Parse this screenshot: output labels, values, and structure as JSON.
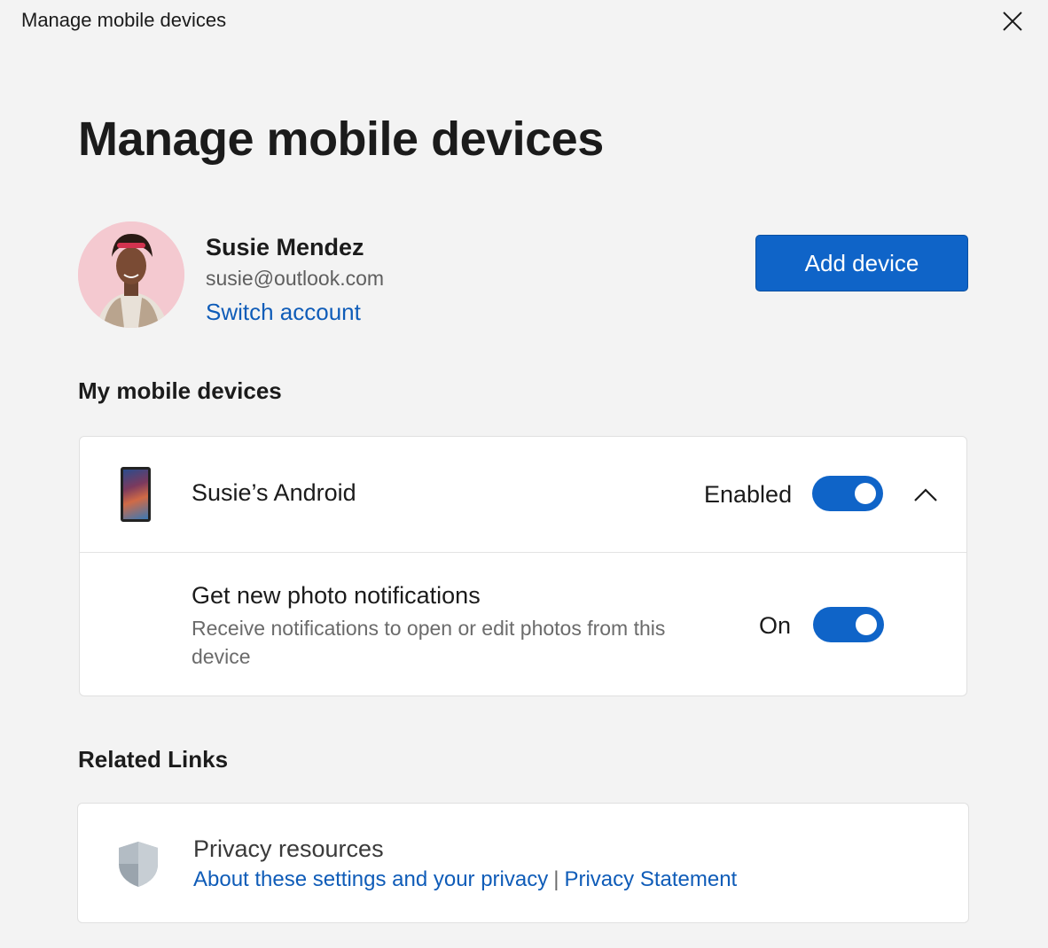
{
  "window": {
    "title": "Manage mobile devices"
  },
  "page": {
    "title": "Manage mobile devices"
  },
  "account": {
    "name": "Susie Mendez",
    "email": "susie@outlook.com",
    "switch_label": "Switch account"
  },
  "actions": {
    "add_device_label": "Add device"
  },
  "devices_section": {
    "heading": "My mobile devices",
    "device": {
      "name": "Susie’s Android",
      "status_label": "Enabled",
      "enabled": true,
      "expanded": true,
      "settings": [
        {
          "title": "Get new photo notifications",
          "description": "Receive notifications to open or edit photos from this device",
          "state_label": "On",
          "on": true
        }
      ]
    }
  },
  "related_links": {
    "heading": "Related Links",
    "privacy": {
      "title": "Privacy resources",
      "link1": "About these settings and your privacy",
      "separator": "|",
      "link2": "Privacy Statement"
    }
  },
  "colors": {
    "accent": "#0f64c8",
    "link": "#0f5cb8",
    "background": "#f3f3f3"
  },
  "icons": {
    "close": "close-icon",
    "chevron": "chevron-up-icon",
    "shield": "shield-icon",
    "phone": "phone-icon"
  }
}
